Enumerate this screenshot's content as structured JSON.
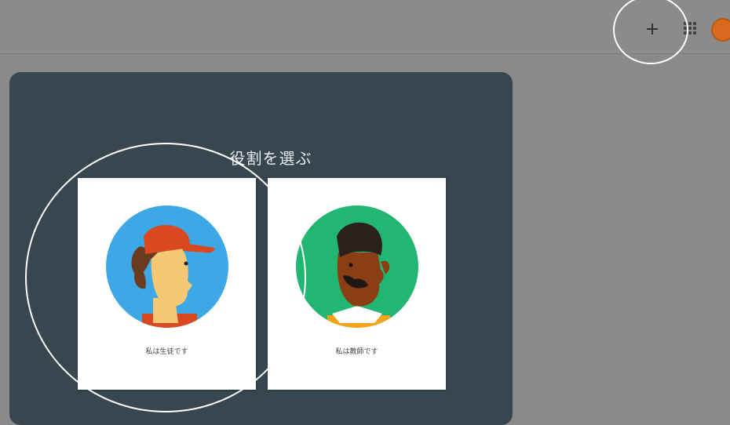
{
  "header": {
    "icons": {
      "create": "plus-icon",
      "apps": "apps-grid-icon",
      "account": "account-avatar"
    }
  },
  "dialog": {
    "title": "役割を選ぶ",
    "roles": [
      {
        "id": "student",
        "label": "私は生徒です",
        "illustration": "student-illustration",
        "bg_color": "#3ea8e6"
      },
      {
        "id": "teacher",
        "label": "私は教師です",
        "illustration": "teacher-illustration",
        "bg_color": "#22b673"
      }
    ]
  },
  "colors": {
    "overlay": "#8a8a8a",
    "dialog_bg": "#37464f",
    "card_bg": "#ffffff",
    "avatar": "#d9691f",
    "annotation": "#ffffff"
  }
}
